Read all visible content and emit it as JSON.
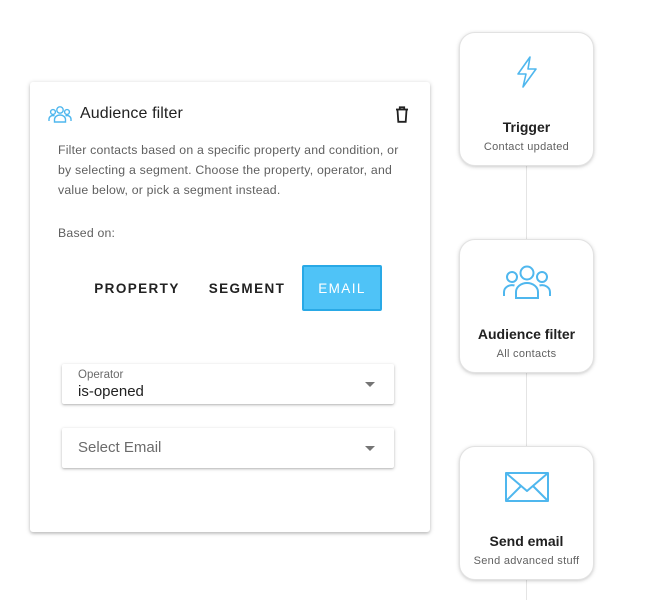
{
  "panel": {
    "title": "Audience filter",
    "header_icon": "users-group-icon",
    "delete_icon": "trash-icon",
    "description": "Filter contacts based on a specific property and condition, or by selecting a segment. Choose the property, operator, and value below, or pick a segment instead.",
    "based_on_label": "Based on:",
    "toggles": [
      {
        "label": "PROPERTY",
        "active": false
      },
      {
        "label": "SEGMENT",
        "active": false
      },
      {
        "label": "EMAIL",
        "active": true
      }
    ],
    "operator": {
      "label": "Operator",
      "value": "is-opened"
    },
    "email_select": {
      "placeholder": "Select Email"
    }
  },
  "flow": {
    "nodes": [
      {
        "title": "Trigger",
        "subtitle": "Contact updated",
        "icon": "lightning-bolt-icon"
      },
      {
        "title": "Audience filter",
        "subtitle": "All contacts",
        "icon": "users-group-icon"
      },
      {
        "title": "Send email",
        "subtitle": "Send advanced stuff",
        "icon": "envelope-icon"
      }
    ]
  },
  "colors": {
    "accent": "#4fc3f7",
    "accent_border": "#29a9e6",
    "icon_blue": "#4fb7ee",
    "text": "#212121",
    "muted": "#5f5f5f"
  }
}
